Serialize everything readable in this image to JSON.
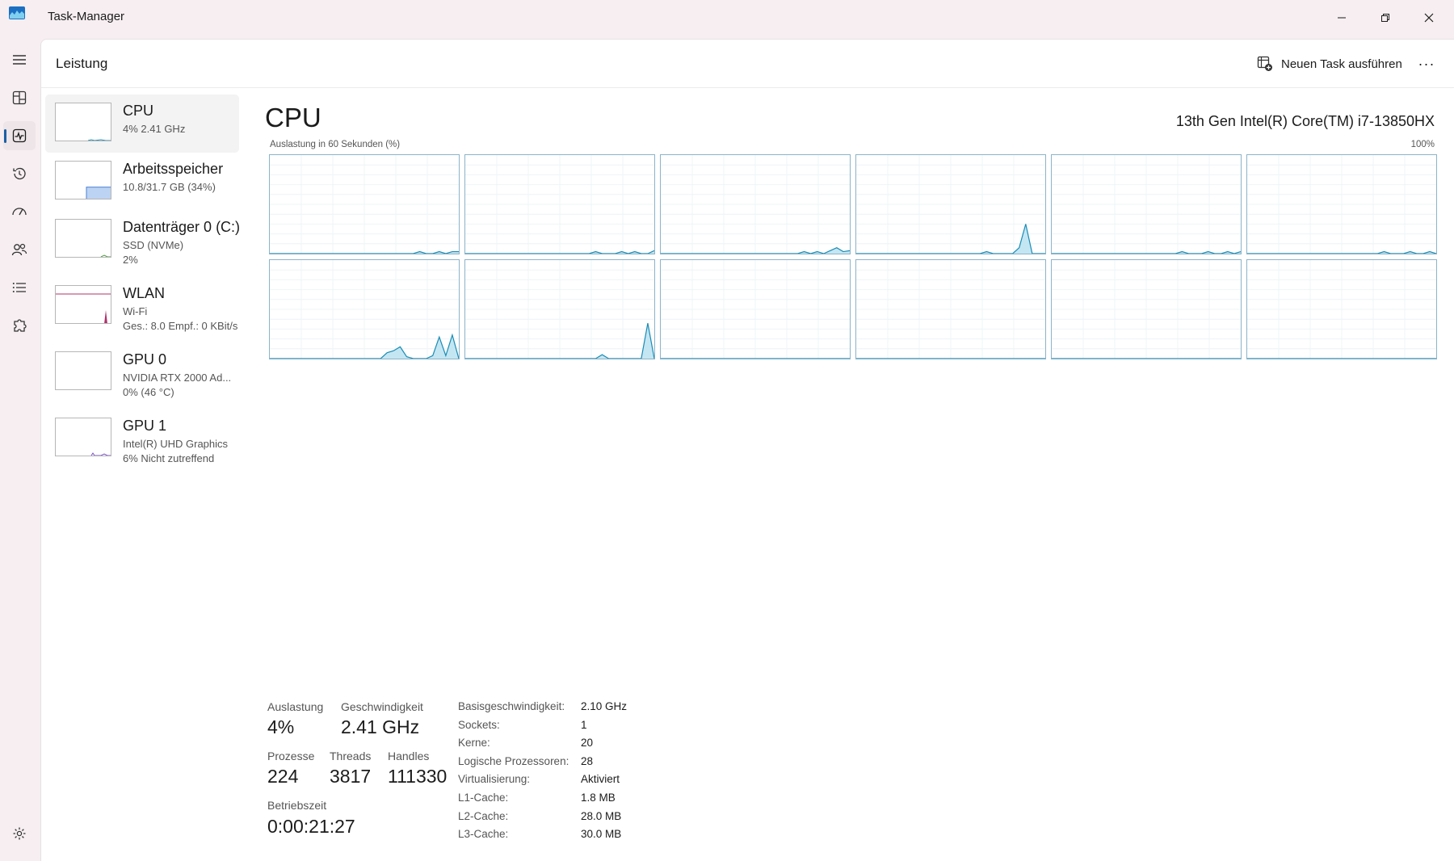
{
  "window": {
    "title": "Task-Manager",
    "icons": [
      "task-manager-logo",
      "minimize-icon",
      "restore-icon",
      "close-icon"
    ]
  },
  "nav": {
    "items": [
      "hamburger-menu",
      "processes",
      "performance",
      "app-history",
      "startup-apps",
      "users",
      "details",
      "services",
      "settings"
    ],
    "active": "performance"
  },
  "header": {
    "title": "Leistung",
    "new_task": "Neuen Task ausführen",
    "more": "···"
  },
  "resources": [
    {
      "name": "CPU",
      "line1": "4%  2.41 GHz",
      "line2": "",
      "active": true,
      "color": "#1a8cb4"
    },
    {
      "name": "Arbeitsspeicher",
      "line1": "10.8/31.7 GB (34%)",
      "line2": "",
      "active": false,
      "color": "#4a7fd6",
      "level": 0.34
    },
    {
      "name": "Datenträger 0 (C:)",
      "line1": "SSD (NVMe)",
      "line2": "2%",
      "active": false,
      "color": "#4d9a3c"
    },
    {
      "name": "WLAN",
      "line1": "Wi-Fi",
      "line2": "Ges.: 8.0  Empf.: 0 KBit/s",
      "active": false,
      "color": "#b0306a"
    },
    {
      "name": "GPU 0",
      "line1": "NVIDIA RTX 2000 Ad...",
      "line2": "0%  (46 °C)",
      "active": false,
      "color": "#7b4fc8"
    },
    {
      "name": "GPU 1",
      "line1": "Intel(R) UHD Graphics",
      "line2": "6%  Nicht zutreffend",
      "active": false,
      "color": "#7b4fc8"
    }
  ],
  "cpu": {
    "title": "CPU",
    "model": "13th Gen Intel(R) Core(TM) i7-13850HX",
    "graph_label": "Auslastung in 60 Sekunden (%)",
    "graph_max": "100%",
    "stats": {
      "util_label": "Auslastung",
      "util": "4%",
      "speed_label": "Geschwindigkeit",
      "speed": "2.41 GHz",
      "proc_label": "Prozesse",
      "proc": "224",
      "threads_label": "Threads",
      "threads": "3817",
      "handles_label": "Handles",
      "handles": "111330",
      "uptime_label": "Betriebszeit",
      "uptime": "0:00:21:27"
    },
    "specs": [
      {
        "key": "Basisgeschwindigkeit:",
        "value": "2.10 GHz"
      },
      {
        "key": "Sockets:",
        "value": "1"
      },
      {
        "key": "Kerne:",
        "value": "20"
      },
      {
        "key": "Logische Prozessoren:",
        "value": "28"
      },
      {
        "key": "Virtualisierung:",
        "value": "Aktiviert"
      },
      {
        "key": "L1-Cache:",
        "value": "1.8 MB"
      },
      {
        "key": "L2-Cache:",
        "value": "28.0 MB"
      },
      {
        "key": "L3-Cache:",
        "value": "30.0 MB"
      }
    ]
  },
  "chart_data": {
    "type": "area",
    "ylim": [
      0,
      100
    ],
    "samples": 30,
    "color": "#1a8cb4",
    "fill": "#c4e6f3",
    "series": [
      {
        "values": [
          0,
          0,
          0,
          0,
          0,
          0,
          0,
          0,
          0,
          0,
          0,
          0,
          0,
          0,
          0,
          0,
          0,
          0,
          0,
          0,
          0,
          0,
          0,
          2,
          0,
          0,
          2,
          0,
          2,
          2
        ]
      },
      {
        "values": [
          0,
          0,
          0,
          0,
          0,
          0,
          0,
          0,
          0,
          0,
          0,
          0,
          0,
          0,
          0,
          0,
          0,
          0,
          0,
          0,
          2,
          0,
          0,
          0,
          2,
          0,
          2,
          0,
          0,
          3
        ]
      },
      {
        "values": [
          0,
          0,
          0,
          0,
          0,
          0,
          0,
          0,
          0,
          0,
          0,
          0,
          0,
          0,
          0,
          0,
          0,
          0,
          0,
          0,
          0,
          0,
          2,
          0,
          2,
          0,
          3,
          6,
          2,
          3
        ]
      },
      {
        "values": [
          0,
          0,
          0,
          0,
          0,
          0,
          0,
          0,
          0,
          0,
          0,
          0,
          0,
          0,
          0,
          0,
          0,
          0,
          0,
          0,
          2,
          0,
          0,
          0,
          0,
          6,
          30,
          0,
          0,
          0
        ]
      },
      {
        "values": [
          0,
          0,
          0,
          0,
          0,
          0,
          0,
          0,
          0,
          0,
          0,
          0,
          0,
          0,
          0,
          0,
          0,
          0,
          0,
          0,
          2,
          0,
          0,
          0,
          2,
          0,
          0,
          2,
          0,
          2
        ]
      },
      {
        "values": [
          0,
          0,
          0,
          0,
          0,
          0,
          0,
          0,
          0,
          0,
          0,
          0,
          0,
          0,
          0,
          0,
          0,
          0,
          0,
          0,
          0,
          2,
          0,
          0,
          0,
          2,
          0,
          0,
          2,
          0
        ]
      },
      {
        "values": [
          0,
          0,
          0,
          0,
          0,
          0,
          0,
          0,
          0,
          0,
          0,
          0,
          0,
          0,
          0,
          0,
          0,
          0,
          6,
          8,
          12,
          2,
          0,
          0,
          0,
          3,
          22,
          3,
          24,
          0
        ]
      },
      {
        "values": [
          0,
          0,
          0,
          0,
          0,
          0,
          0,
          0,
          0,
          0,
          0,
          0,
          0,
          0,
          0,
          0,
          0,
          0,
          0,
          0,
          0,
          4,
          0,
          0,
          0,
          0,
          0,
          0,
          36,
          0
        ]
      },
      {
        "values": [
          0,
          0,
          0,
          0,
          0,
          0,
          0,
          0,
          0,
          0,
          0,
          0,
          0,
          0,
          0,
          0,
          0,
          0,
          0,
          0,
          0,
          0,
          0,
          0,
          0,
          0,
          0,
          0,
          0,
          0
        ]
      },
      {
        "values": [
          0,
          0,
          0,
          0,
          0,
          0,
          0,
          0,
          0,
          0,
          0,
          0,
          0,
          0,
          0,
          0,
          0,
          0,
          0,
          0,
          0,
          0,
          0,
          0,
          0,
          0,
          0,
          0,
          0,
          0
        ]
      },
      {
        "values": [
          0,
          0,
          0,
          0,
          0,
          0,
          0,
          0,
          0,
          0,
          0,
          0,
          0,
          0,
          0,
          0,
          0,
          0,
          0,
          0,
          0,
          0,
          0,
          0,
          0,
          0,
          0,
          0,
          0,
          0
        ]
      },
      {
        "values": [
          0,
          0,
          0,
          0,
          0,
          0,
          0,
          0,
          0,
          0,
          0,
          0,
          0,
          0,
          0,
          0,
          0,
          0,
          0,
          0,
          0,
          0,
          0,
          0,
          0,
          0,
          0,
          0,
          0,
          0
        ]
      }
    ]
  }
}
